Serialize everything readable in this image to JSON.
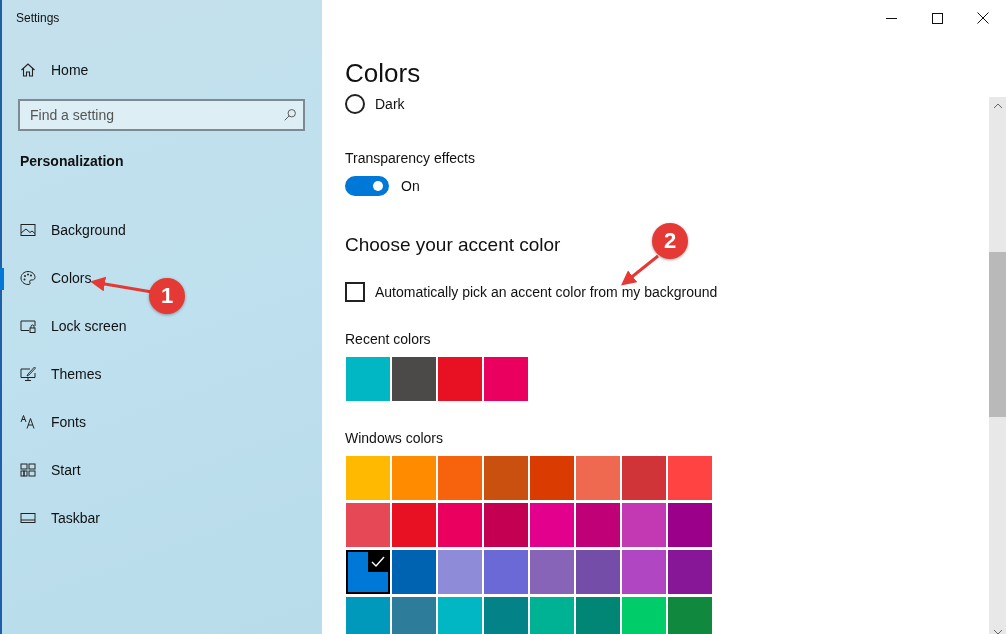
{
  "window": {
    "title": "Settings"
  },
  "sidebar": {
    "home": "Home",
    "search": {
      "placeholder": "Find a setting"
    },
    "section": "Personalization",
    "items": [
      {
        "label": "Background",
        "selected": false
      },
      {
        "label": "Colors",
        "selected": true
      },
      {
        "label": "Lock screen",
        "selected": false
      },
      {
        "label": "Themes",
        "selected": false
      },
      {
        "label": "Fonts",
        "selected": false
      },
      {
        "label": "Start",
        "selected": false
      },
      {
        "label": "Taskbar",
        "selected": false
      }
    ]
  },
  "content": {
    "title": "Colors",
    "mode_option": {
      "label": "Dark",
      "selected": false
    },
    "transparency": {
      "label": "Transparency effects",
      "on": true,
      "state_label": "On"
    },
    "accent_heading": "Choose your accent color",
    "auto_pick": {
      "label": "Automatically pick an accent color from my background",
      "checked": false
    },
    "recent_label": "Recent colors",
    "recent_colors": [
      {
        "color": "#00b7c3"
      },
      {
        "color": "#4c4a48"
      },
      {
        "color": "#e81123"
      },
      {
        "color": "#ea005e"
      }
    ],
    "windows_label": "Windows colors",
    "windows_colors": [
      {
        "color": "#ffb900",
        "selected": false
      },
      {
        "color": "#ff8c00",
        "selected": false
      },
      {
        "color": "#f7630c",
        "selected": false
      },
      {
        "color": "#ca5010",
        "selected": false
      },
      {
        "color": "#da3b01",
        "selected": false
      },
      {
        "color": "#ef6950",
        "selected": false
      },
      {
        "color": "#d13438",
        "selected": false
      },
      {
        "color": "#ff4343",
        "selected": false
      },
      {
        "color": "#e74856",
        "selected": false
      },
      {
        "color": "#e81123",
        "selected": false
      },
      {
        "color": "#ea005e",
        "selected": false
      },
      {
        "color": "#c30052",
        "selected": false
      },
      {
        "color": "#e3008c",
        "selected": false
      },
      {
        "color": "#bf0077",
        "selected": false
      },
      {
        "color": "#c239b3",
        "selected": false
      },
      {
        "color": "#9a0089",
        "selected": false
      },
      {
        "color": "#0078d7",
        "selected": true
      },
      {
        "color": "#0063b1",
        "selected": false
      },
      {
        "color": "#8e8cd8",
        "selected": false
      },
      {
        "color": "#6b69d6",
        "selected": false
      },
      {
        "color": "#8764b8",
        "selected": false
      },
      {
        "color": "#744da9",
        "selected": false
      },
      {
        "color": "#b146c2",
        "selected": false
      },
      {
        "color": "#881798",
        "selected": false
      },
      {
        "color": "#0099bc",
        "selected": false
      },
      {
        "color": "#2d7d9a",
        "selected": false
      },
      {
        "color": "#00b7c3",
        "selected": false
      },
      {
        "color": "#038387",
        "selected": false
      },
      {
        "color": "#00b294",
        "selected": false
      },
      {
        "color": "#018574",
        "selected": false
      },
      {
        "color": "#00cc6a",
        "selected": false
      },
      {
        "color": "#10893e",
        "selected": false
      }
    ]
  },
  "annotations": [
    {
      "label": "1"
    },
    {
      "label": "2"
    }
  ]
}
